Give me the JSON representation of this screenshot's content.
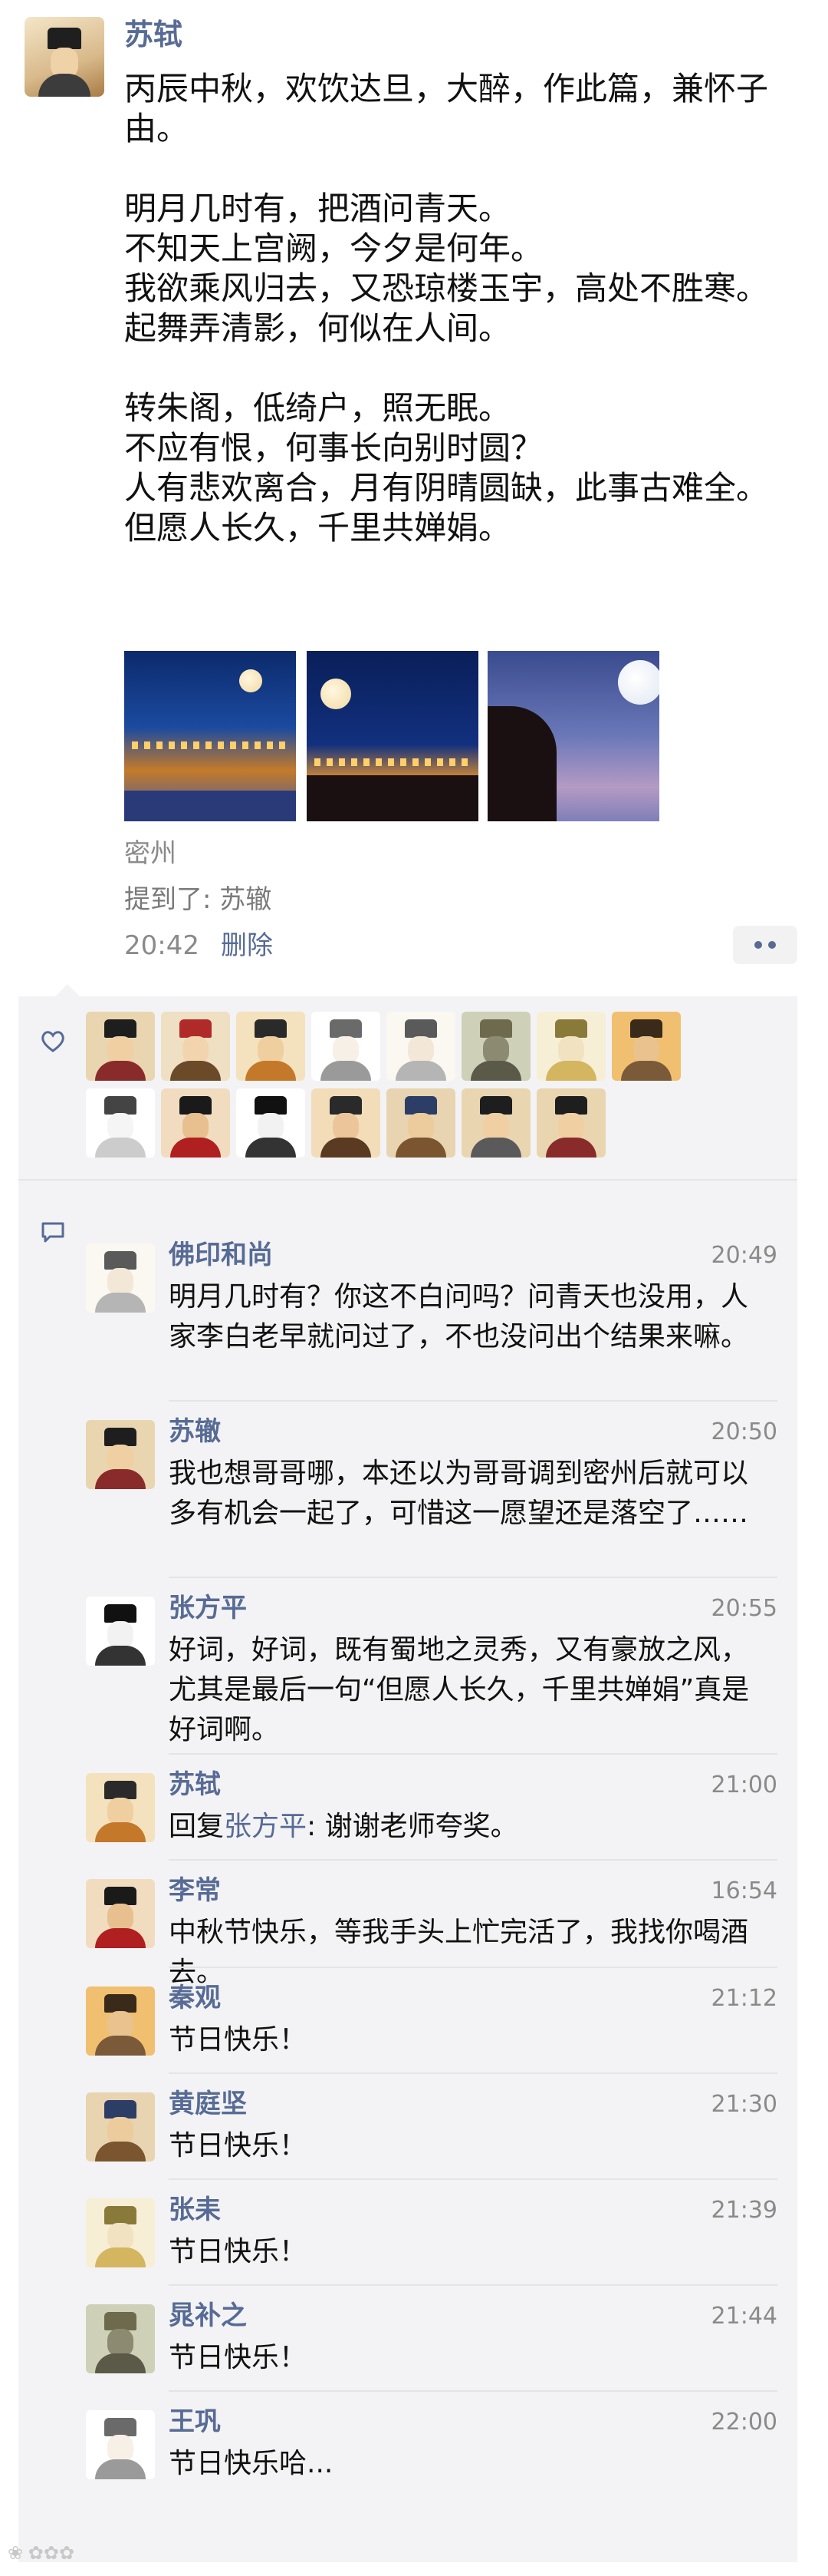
{
  "post": {
    "author": "苏轼",
    "lines": [
      "丙辰中秋，欢饮达旦，大醉，作此篇，兼怀子由。",
      "",
      "明月几时有，把酒问青天。",
      "不知天上宫阙，今夕是何年。",
      "我欲乘风归去，又恐琼楼玉宇，高处不胜寒。",
      "起舞弄清影，何似在人间。",
      "",
      "转朱阁，低绮户，照无眠。",
      "不应有恨，何事长向别时圆？",
      "人有悲欢离合，月有阴晴圆缺，此事古难全。",
      "但愿人长久，千里共婵娟。"
    ],
    "location": "密州",
    "mention_prefix": "提到了: ",
    "mention_name": "苏辙",
    "time": "20:42",
    "delete_label": "删除",
    "photo_count": 3
  },
  "icons": {
    "like": "heart-icon",
    "comment": "comment-icon",
    "more": "more-dots-icon"
  },
  "colors": {
    "name_link": "#576b95",
    "comment_background": "#f3f3f5",
    "secondary_text": "#8a8a8a"
  },
  "likes": {
    "count": 15
  },
  "comments": [
    {
      "name": "佛印和尚",
      "time": "20:49",
      "text": "明月几时有？你这不白问吗？问青天也没用，人家李白老早就问过了，不也没问出个结果来嘛。"
    },
    {
      "name": "苏辙",
      "time": "20:50",
      "text": "我也想哥哥哪，本还以为哥哥调到密州后就可以多有机会一起了，可惜这一愿望还是落空了……"
    },
    {
      "name": "张方平",
      "time": "20:55",
      "text": "好词，好词，既有蜀地之灵秀，又有豪放之风，尤其是最后一句“但愿人长久，千里共婵娟”真是好词啊。"
    },
    {
      "name": "苏轼",
      "time": "21:00",
      "reply_prefix": "回复",
      "reply_to": "张方平",
      "reply_text": ": 谢谢老师夸奖。"
    },
    {
      "name": "李常",
      "time": "16:54",
      "text": "中秋节快乐，等我手头上忙完活了，我找你喝酒去。"
    },
    {
      "name": "秦观",
      "time": "21:12",
      "text": "节日快乐！"
    },
    {
      "name": "黄庭坚",
      "time": "21:30",
      "text": "节日快乐！"
    },
    {
      "name": "张耒",
      "time": "21:39",
      "text": "节日快乐！"
    },
    {
      "name": "晁补之",
      "time": "21:44",
      "text": "节日快乐！"
    },
    {
      "name": "王巩",
      "time": "22:00",
      "text": "节日快乐哈..."
    }
  ]
}
